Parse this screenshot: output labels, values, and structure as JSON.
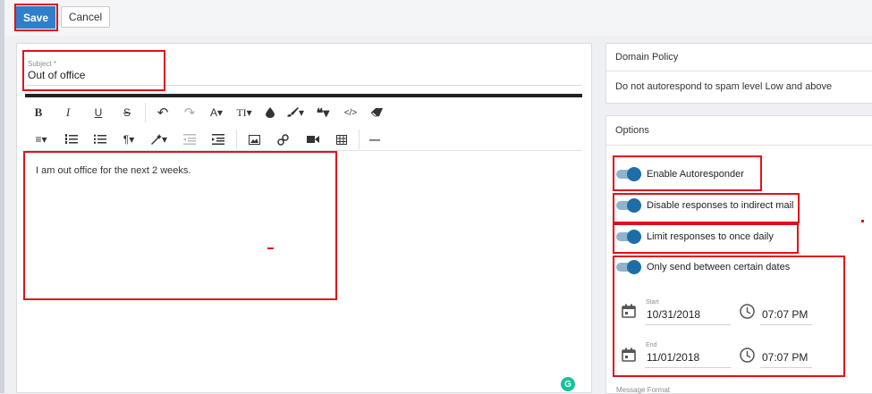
{
  "toolbar": {
    "save_label": "Save",
    "cancel_label": "Cancel"
  },
  "subject": {
    "label": "Subject *",
    "value": "Out of office"
  },
  "editor": {
    "format_row1": [
      {
        "name": "bold-icon",
        "glyph": "B"
      },
      {
        "name": "italic-icon",
        "glyph": "I"
      },
      {
        "name": "underline-icon",
        "glyph": "U"
      },
      {
        "name": "strikethrough-icon",
        "glyph": "S"
      },
      {
        "name": "undo-icon",
        "glyph": "↶"
      },
      {
        "name": "redo-icon",
        "glyph": "↷"
      },
      {
        "name": "font-color-icon",
        "glyph": "A▾"
      },
      {
        "name": "font-size-icon",
        "glyph": "TI▾"
      },
      {
        "name": "ink-drop-icon",
        "glyph": "💧"
      },
      {
        "name": "paint-brush-icon",
        "glyph": "🖌▾"
      },
      {
        "name": "quote-icon",
        "glyph": "❝▾"
      },
      {
        "name": "code-icon",
        "glyph": "</>"
      },
      {
        "name": "eraser-icon",
        "glyph": "⌫"
      }
    ],
    "format_row2": [
      {
        "name": "align-icon",
        "glyph": "≡▾"
      },
      {
        "name": "ordered-list-icon",
        "glyph": "⋮≡"
      },
      {
        "name": "unordered-list-icon",
        "glyph": "•≡"
      },
      {
        "name": "paragraph-icon",
        "glyph": "¶▾"
      },
      {
        "name": "magic-wand-icon",
        "glyph": "✎▾"
      },
      {
        "name": "outdent-icon",
        "glyph": "⇤"
      },
      {
        "name": "indent-icon",
        "glyph": "⇥"
      },
      {
        "name": "image-icon",
        "glyph": "🖼"
      },
      {
        "name": "link-icon",
        "glyph": "🔗"
      },
      {
        "name": "video-icon",
        "glyph": "🎥"
      },
      {
        "name": "table-icon",
        "glyph": "▦"
      },
      {
        "name": "horizontal-rule-icon",
        "glyph": "—"
      }
    ],
    "body": "I am out office for the next 2 weeks."
  },
  "domain_policy": {
    "title": "Domain Policy",
    "text": "Do not autorespond to spam level Low and above"
  },
  "options": {
    "title": "Options",
    "enable": "Enable Autoresponder",
    "disable_indirect": "Disable responses to indirect mail",
    "limit_daily": "Limit responses to once daily",
    "only_dates": "Only send between certain dates",
    "start_label": "Start",
    "start_date": "10/31/2018",
    "start_time": "07:07 PM",
    "end_label": "End",
    "end_date": "11/01/2018",
    "end_time": "07:07 PM",
    "toggles_on": [
      true,
      true,
      true,
      true
    ]
  },
  "message_format_label": "Message Format",
  "colors": {
    "accent": "#2f7fca",
    "toggle": "#1d6ea8",
    "highlight": "#e3101a"
  }
}
